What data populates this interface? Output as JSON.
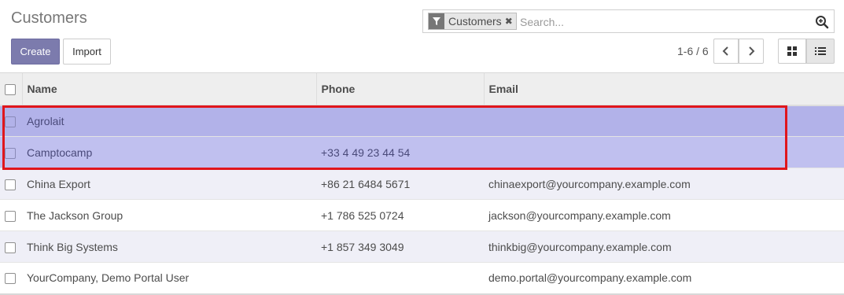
{
  "header": {
    "title": "Customers",
    "create_label": "Create",
    "import_label": "Import"
  },
  "search": {
    "facet_icon": "filter-icon",
    "facet_label": "Customers",
    "facet_remove": "✖",
    "placeholder": "Search...",
    "value": "",
    "search_icon": "magnifier-plus-icon"
  },
  "pager": {
    "value": "1-6 / 6",
    "prev_icon": "chevron-left-icon",
    "next_icon": "chevron-right-icon"
  },
  "view_switcher": {
    "kanban_icon": "kanban-grid-icon",
    "list_icon": "list-icon",
    "active": "list"
  },
  "table": {
    "columns": [
      "Name",
      "Phone",
      "Email"
    ],
    "rows": [
      {
        "name": "Agrolait",
        "phone": "",
        "email": "",
        "state": "selected"
      },
      {
        "name": "Camptocamp",
        "phone": "+33 4 49 23 44 54",
        "email": "",
        "state": "selected"
      },
      {
        "name": "China Export",
        "phone": "+86 21 6484 5671",
        "email": "chinaexport@yourcompany.example.com",
        "state": "normal"
      },
      {
        "name": "The Jackson Group",
        "phone": "+1 786 525 0724",
        "email": "jackson@yourcompany.example.com",
        "state": "normal"
      },
      {
        "name": "Think Big Systems",
        "phone": "+1 857 349 3049",
        "email": "thinkbig@yourcompany.example.com",
        "state": "normal"
      },
      {
        "name": "YourCompany, Demo Portal User",
        "phone": "",
        "email": "demo.portal@yourcompany.example.com",
        "state": "normal"
      }
    ]
  },
  "colors": {
    "primary": "#7c7bad",
    "selected_row": "#b2b2e9",
    "highlight_border": "#e0161c"
  }
}
